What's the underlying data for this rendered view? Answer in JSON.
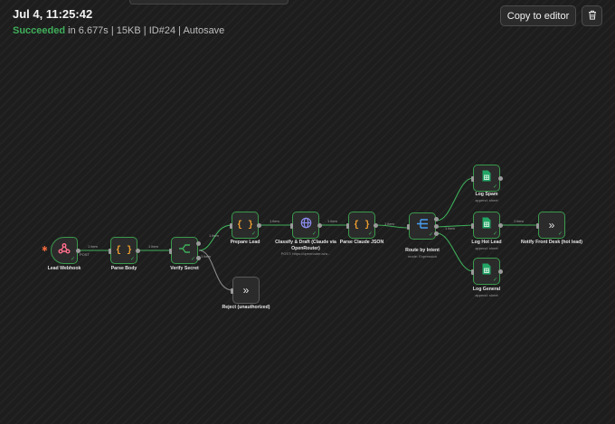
{
  "execution": {
    "date": "Jul 4, 11:25:42",
    "status": "Succeeded",
    "duration": "in 6.677s",
    "size": "15KB",
    "id": "ID#24",
    "autosave": "Autosave",
    "sep": "|"
  },
  "toolbar": {
    "copy_label": "Copy to editor",
    "delete_icon": "trash-icon"
  },
  "colors": {
    "success": "#3fae5a",
    "node_bg": "#2b2b2b",
    "trigger_icon": "#ff6d8a",
    "code_icon": "#f0a030",
    "http_icon": "#8a8cf0",
    "switch_icon": "#4a9df0",
    "sheets_icon": "#22a565",
    "trigger_bolt": "#f0693e"
  },
  "edges": {
    "webhook_post": "POST",
    "webhook_item": "1 item",
    "parse_item": "1 item",
    "verify_true": "1 item",
    "verify_false": "1 item",
    "prepare_item": "1 item",
    "classify_item": "1 item",
    "parse_claude_item": "1 item",
    "route_item": "1 item",
    "loghot_item": "1 item"
  },
  "nodes": [
    {
      "id": "lead-webhook",
      "name": "Lead Webhook",
      "icon": "webhook-icon"
    },
    {
      "id": "parse-body",
      "name": "Parse Body",
      "icon": "code-braces-icon"
    },
    {
      "id": "verify-secret",
      "name": "Verify Secret",
      "icon": "if-branch-icon"
    },
    {
      "id": "prepare-lead",
      "name": "Prepare Lead",
      "icon": "code-braces-icon"
    },
    {
      "id": "reject",
      "name": "Reject (unauthorized)",
      "icon": "double-chevron-icon"
    },
    {
      "id": "classify",
      "name": "Classify & Draft (Claude via OpenRouter)",
      "sub": "POST: https://openrouter.ai/a...",
      "icon": "globe-icon"
    },
    {
      "id": "parse-claude",
      "name": "Parse Claude JSON",
      "icon": "code-braces-icon"
    },
    {
      "id": "route-intent",
      "name": "Route by Intent",
      "sub": "mode: Expression",
      "icon": "switch-icon"
    },
    {
      "id": "log-spam",
      "name": "Log Spam",
      "sub": "append: sheet",
      "icon": "sheets-icon"
    },
    {
      "id": "log-hot",
      "name": "Log Hot Lead",
      "sub": "append: sheet",
      "icon": "sheets-icon"
    },
    {
      "id": "log-general",
      "name": "Log General",
      "sub": "append: sheet",
      "icon": "sheets-icon"
    },
    {
      "id": "notify",
      "name": "Notify Front Desk (hot lead)",
      "icon": "double-chevron-icon"
    }
  ]
}
